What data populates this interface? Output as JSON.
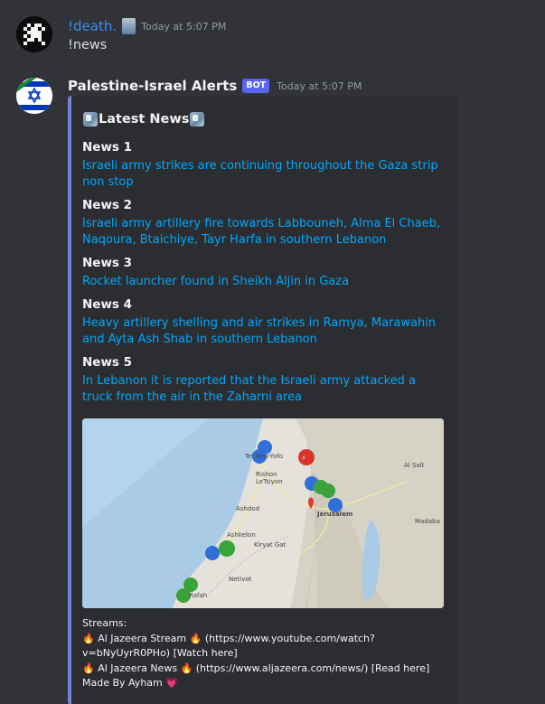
{
  "messages": [
    {
      "username": "!death.",
      "timestamp": "Today at 5:07 PM",
      "content": "!news"
    },
    {
      "username": "Palestine-Israel Alerts",
      "bot_tag": "BOT",
      "timestamp": "Today at 5:07 PM",
      "embed": {
        "title": "Latest News",
        "news": [
          {
            "label": "News 1",
            "text": "Israeli army strikes are continuing throughout the Gaza strip non stop"
          },
          {
            "label": "News 2",
            "text": "Israeli army artillery fire towards Labbouneh, Alma El Chaeb, Naqoura, Btaichiye, Tayr Harfa in southern Lebanon"
          },
          {
            "label": "News 3",
            "text": "Rocket launcher found in Sheikh Aljin in Gaza"
          },
          {
            "label": "News 4",
            "text": "Heavy artillery shelling and air strikes in Ramya, Marawahin and Ayta Ash Shab in southern Lebanon"
          },
          {
            "label": "News 5",
            "text": "In Lebanon it is reported that the Israeli army attacked a truck from the air in the Zaharni area"
          }
        ],
        "map_labels": {
          "tel_aviv": "Tel Aviv-Yafo",
          "rishon": "Rishon LeTsiyon",
          "ashdod": "Ashdod",
          "ashkelon": "Ashkelon",
          "kiryat_gat": "Kiryat Gat",
          "netivot": "Netivot",
          "rafah": "Rafah",
          "jerusalem": "Jerusalem",
          "al_salt": "Al Salt",
          "madaba": "Madaba"
        },
        "streams": {
          "heading": "Streams:",
          "line1": "🔥 Al Jazeera Stream 🔥 (https://www.youtube.com/watch?",
          "line2": "v=bNyUyrR0PHo)  [Watch here]",
          "line3": "🔥 Al Jazeera News 🔥 (https://www.aljazeera.com/news/)  [Read here]",
          "credit": "Made By Ayham",
          "heart": "💗"
        }
      }
    }
  ],
  "colors": {
    "background": "#313338",
    "embed_bg": "#2b2d31",
    "embed_border": "#7683d6",
    "link": "#00a8fc",
    "bot_tag": "#5865f2",
    "username1": "#3c8ef0"
  }
}
